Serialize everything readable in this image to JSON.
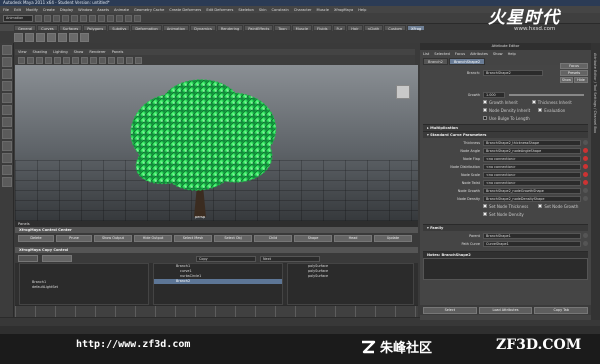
{
  "titlebar": {
    "title": "Autodesk Maya 2011 x64 - Student Version: untitled*"
  },
  "menubar": {
    "items": [
      "File",
      "Edit",
      "Modify",
      "Create",
      "Display",
      "Window",
      "Assets",
      "Animate",
      "Geometry Cache",
      "Create Deformers",
      "Edit Deformers",
      "Skeleton",
      "Skin",
      "Constrain",
      "Character",
      "Muscle",
      "XfrogMaya",
      "Help"
    ]
  },
  "menu_mode": "Animation",
  "shelf": {
    "tabs": [
      "General",
      "Curves",
      "Surfaces",
      "Polygons",
      "Subdivs",
      "Deformation",
      "Animation",
      "Dynamics",
      "Rendering",
      "PaintEffects",
      "Toon",
      "Muscle",
      "Fluids",
      "Fur",
      "Hair",
      "nCloth",
      "Custom",
      "XFrog"
    ],
    "active": "XFrog"
  },
  "panel": {
    "menu": [
      "View",
      "Shading",
      "Lighting",
      "Show",
      "Renderer",
      "Panels"
    ],
    "status": "persp"
  },
  "panels_bar": "Panels",
  "control_center": {
    "title": "XfrogMaya Control Center",
    "buttons": [
      "Delete",
      "Prune",
      "Show Output",
      "Hide Output",
      "Select Mesh",
      "Select Obj",
      "Child",
      "Shape",
      "Head",
      "Update"
    ]
  },
  "copy_control": {
    "title": "XfrogMaya Copy Control",
    "fields": [
      "Copy",
      "Next"
    ]
  },
  "outliner": {
    "col1": [
      "Branch1",
      "defaultLightSet"
    ],
    "col2": [
      "Branch1",
      "curve1",
      "nurbsCircle1",
      "Branch2"
    ],
    "col3": [
      "polySurface",
      "polySurface",
      "polySurface"
    ],
    "selected_col2": "Branch2"
  },
  "attribute_editor": {
    "title": "Attribute Editor",
    "menu": [
      "List",
      "Selected",
      "Focus",
      "Attributes",
      "Show",
      "Help"
    ],
    "tabs": [
      "Branch2",
      "BranchShape2"
    ],
    "active_tab": "BranchShape2",
    "node_label": "Branch:",
    "node_value": "BranchShape2",
    "side_buttons": [
      "Focus",
      "Presets",
      "Show",
      "Hide"
    ],
    "growth": {
      "label": "Growth",
      "value": "1.000"
    },
    "checks_row1": [
      {
        "label": "Growth Inherit",
        "on": true
      },
      {
        "label": "Thickness Inherit",
        "on": true
      }
    ],
    "checks_row2": [
      {
        "label": "Node Density Inherit",
        "on": true
      },
      {
        "label": "Evaluation",
        "on": true
      }
    ],
    "check_single": {
      "label": "Use Bulge To Length",
      "on": false
    },
    "sections": [
      "Multiplication",
      "Standard Curve Parameters",
      "Family",
      "Notes: BranchShape2"
    ],
    "params": [
      {
        "label": "Thickness",
        "value": "BranchShape2_thicknessShape",
        "dot": false
      },
      {
        "label": "Node Angle",
        "value": "BranchShape2_nodeAngleShape",
        "dot": true
      },
      {
        "label": "Node Flap",
        "value": "<no connection>",
        "dot": true
      },
      {
        "label": "Node Distribution",
        "value": "<no connection>",
        "dot": true
      },
      {
        "label": "Node Scale",
        "value": "<no connection>",
        "dot": true
      },
      {
        "label": "Node Twist",
        "value": "<no connection>",
        "dot": true
      },
      {
        "label": "Node Growth",
        "value": "BranchShape2_nodeGrowthShape",
        "dot": false
      },
      {
        "label": "Node Density",
        "value": "BranchShape2_nodeDensityShape",
        "dot": false
      }
    ],
    "checks_row3": [
      {
        "label": "Set Node Thickness",
        "on": true
      },
      {
        "label": "Set Node Growth",
        "on": true
      }
    ],
    "check_single2": {
      "label": "Set Node Density",
      "on": true
    },
    "family": [
      {
        "label": "Parent",
        "value": "BranchShape1"
      },
      {
        "label": "Path Curve",
        "value": "CurveShape1"
      }
    ],
    "footer_buttons": [
      "Select",
      "Load Attributes",
      "Copy Tab"
    ]
  },
  "side_strip": "Attribute Editor / Tool Settings / Channel Box",
  "logo": {
    "main": "火星时代",
    "sub": "www.hxsd.com"
  },
  "watermark": {
    "url": "http://www.zf3d.com",
    "zf": "朱峰社区",
    "zf3d": "ZF3D.COM"
  },
  "colors": {
    "tree": "#27d957",
    "accent": "#6a7d97",
    "selection": "#5d7696"
  }
}
